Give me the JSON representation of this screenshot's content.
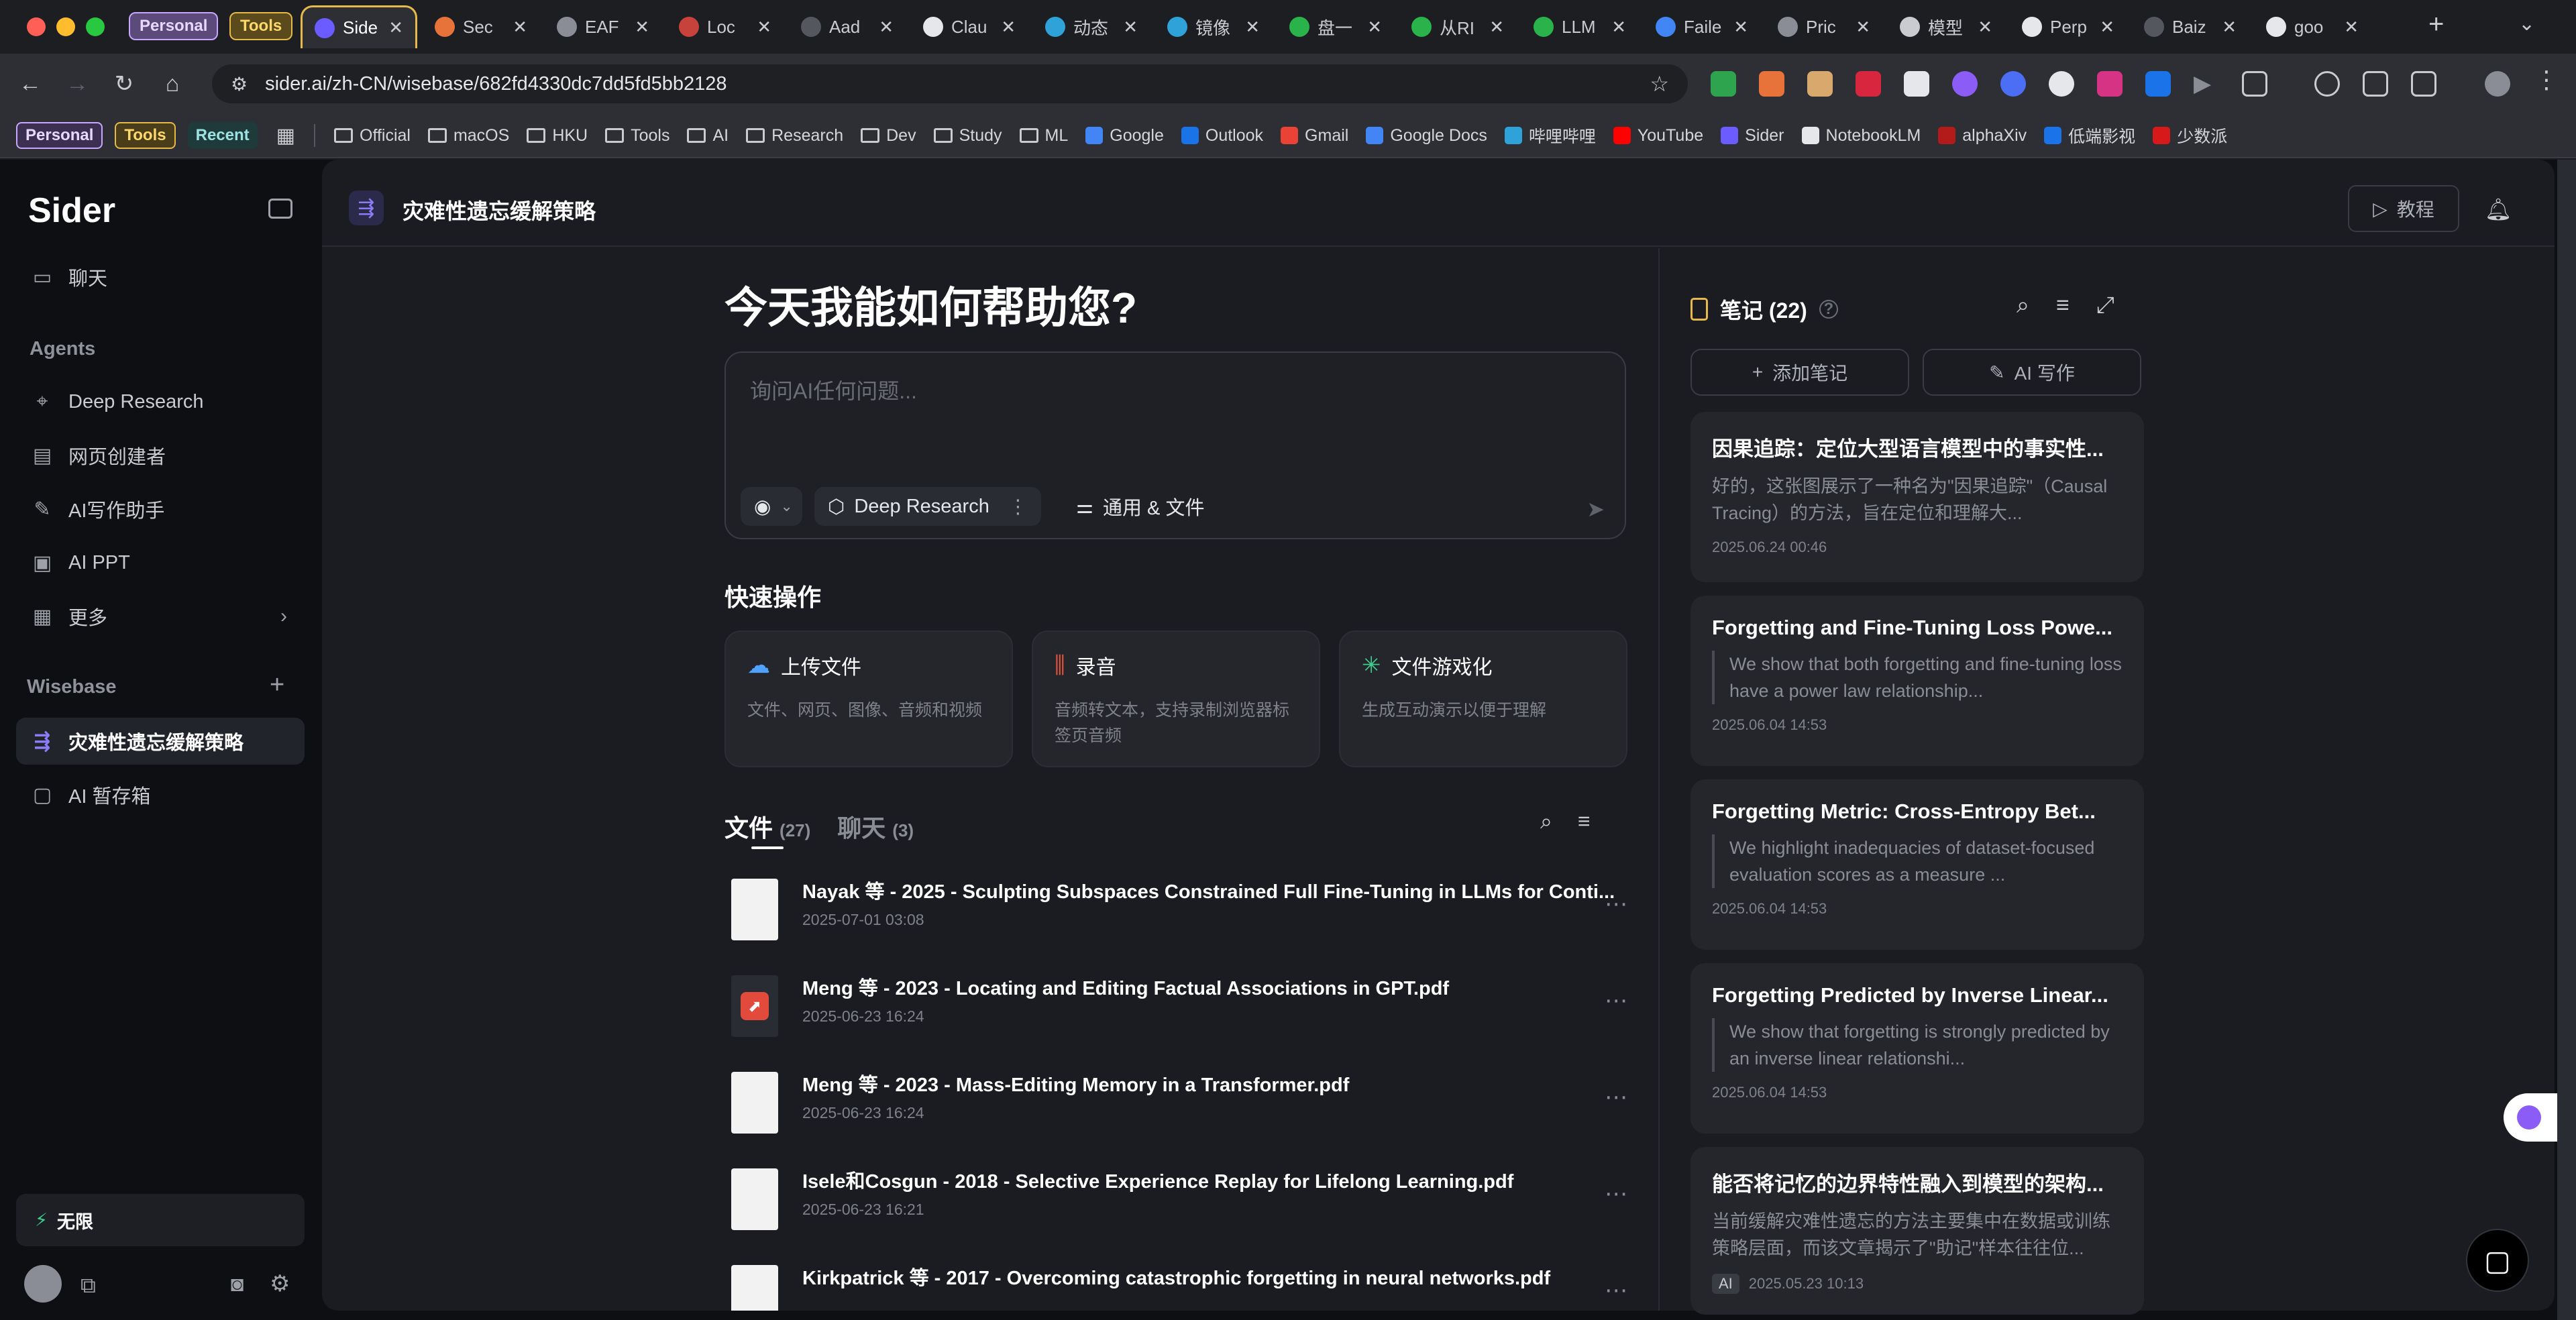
{
  "browser": {
    "groups": [
      "Personal",
      "Tools"
    ],
    "tabs": [
      {
        "title": "Side",
        "color": "#6b5cff",
        "active": true
      },
      {
        "title": "Sec",
        "color": "#e8733a"
      },
      {
        "title": "EAF",
        "color": "#8a8d95"
      },
      {
        "title": "Loc",
        "color": "#c7423a"
      },
      {
        "title": "Aad",
        "color": "#55575e"
      },
      {
        "title": "Clau",
        "color": "#e6e7ea"
      },
      {
        "title": "动态",
        "color": "#2fa3d9"
      },
      {
        "title": "镜像",
        "color": "#2fa3d9"
      },
      {
        "title": "盘一",
        "color": "#29b34a"
      },
      {
        "title": "从RI",
        "color": "#29b34a"
      },
      {
        "title": "LLM",
        "color": "#29b34a"
      },
      {
        "title": "Faile",
        "color": "#4285f4"
      },
      {
        "title": "Pric",
        "color": "#8a8d95"
      },
      {
        "title": "模型",
        "color": "#c9cbd1"
      },
      {
        "title": "Perp",
        "color": "#e6e7ea"
      },
      {
        "title": "Baiz",
        "color": "#55575e"
      },
      {
        "title": "goo",
        "color": "#e6e7ea"
      }
    ],
    "url": "sider.ai/zh-CN/wisebase/682fd4330dc7dd5fd5bb2128",
    "bookmark_groups": [
      "Personal",
      "Tools",
      "Recent"
    ],
    "bookmarks": [
      {
        "label": "Official",
        "icon": "folder-icon"
      },
      {
        "label": "macOS",
        "icon": "folder-icon"
      },
      {
        "label": "HKU",
        "icon": "folder-icon"
      },
      {
        "label": "Tools",
        "icon": "folder-icon"
      },
      {
        "label": "AI",
        "icon": "folder-icon"
      },
      {
        "label": "Research",
        "icon": "folder-icon"
      },
      {
        "label": "Dev",
        "icon": "folder-icon"
      },
      {
        "label": "Study",
        "icon": "folder-icon"
      },
      {
        "label": "ML",
        "icon": "folder-icon"
      },
      {
        "label": "Google",
        "icon": "google-icon",
        "color": "#4285f4"
      },
      {
        "label": "Outlook",
        "icon": "outlook-icon",
        "color": "#1a73e8"
      },
      {
        "label": "Gmail",
        "icon": "gmail-icon",
        "color": "#ea4335"
      },
      {
        "label": "Google Docs",
        "icon": "docs-icon",
        "color": "#4285f4"
      },
      {
        "label": "哔哩哔哩",
        "icon": "bilibili-icon",
        "color": "#2fa3d9"
      },
      {
        "label": "YouTube",
        "icon": "youtube-icon",
        "color": "#ff0000"
      },
      {
        "label": "Sider",
        "icon": "sider-icon",
        "color": "#6b5cff"
      },
      {
        "label": "NotebookLM",
        "icon": "notebooklm-icon",
        "color": "#e6e7ea"
      },
      {
        "label": "alphaXiv",
        "icon": "alphaxiv-icon",
        "color": "#b31b1b"
      },
      {
        "label": "低端影视",
        "icon": "ddys-icon",
        "color": "#1a73e8"
      },
      {
        "label": "少数派",
        "icon": "sspai-icon",
        "color": "#d7191a"
      }
    ]
  },
  "sidebar": {
    "logo": "Sider",
    "chat": "聊天",
    "agents_title": "Agents",
    "agents": [
      "Deep Research",
      "网页创建者",
      "AI写作助手",
      "AI PPT",
      "更多"
    ],
    "wisebase_title": "Wisebase",
    "wisebase_items": [
      "灾难性遗忘缓解策略",
      "AI 暂存箱"
    ],
    "plan": "无限"
  },
  "main": {
    "kb_title": "灾难性遗忘缓解策略",
    "tutorial": "教程",
    "greeting": "今天我能如何帮助您?",
    "placeholder": "询问AI任何问题...",
    "deep_research": "Deep Research",
    "scope": "通用 & 文件",
    "quick_title": "快速操作",
    "quick": [
      {
        "title": "上传文件",
        "desc": "文件、网页、图像、音频和视频",
        "color": "#4fa3ff"
      },
      {
        "title": "录音",
        "desc": "音频转文本，支持录制浏览器标签页音频",
        "color": "#e5533d"
      },
      {
        "title": "文件游戏化",
        "desc": "生成互动演示以便于理解",
        "color": "#3ecf8e"
      }
    ],
    "files_tab": "文件",
    "files_count": "(27)",
    "chats_tab": "聊天",
    "chats_count": "(3)",
    "files": [
      {
        "name": "Nayak 等 - 2025 - Sculpting Subspaces Constrained Full Fine-Tuning in LLMs for Conti...",
        "date": "2025-07-01 03:08",
        "kind": "doc"
      },
      {
        "name": "Meng 等 - 2023 - Locating and Editing Factual Associations in GPT.pdf",
        "date": "2025-06-23 16:24",
        "kind": "pdf"
      },
      {
        "name": "Meng 等 - 2023 - Mass-Editing Memory in a Transformer.pdf",
        "date": "2025-06-23 16:24",
        "kind": "doc"
      },
      {
        "name": "Isele和Cosgun - 2018 - Selective Experience Replay for Lifelong Learning.pdf",
        "date": "2025-06-23 16:21",
        "kind": "doc"
      },
      {
        "name": "Kirkpatrick 等 - 2017 - Overcoming catastrophic forgetting in neural networks.pdf",
        "date": "",
        "kind": "doc"
      }
    ]
  },
  "notes": {
    "title": "笔记 (22)",
    "add": "添加笔记",
    "ai_write": "AI 写作",
    "items": [
      {
        "title": "因果追踪：定位大型语言模型中的事实性...",
        "body": "好的，这张图展示了一种名为\"因果追踪\"（Causal Tracing）的方法，旨在定位和理解大...",
        "date": "2025.06.24 00:46",
        "quote": false
      },
      {
        "title": "Forgetting and Fine-Tuning Loss Powe...",
        "body": "We show that both forgetting and fine-tuning loss have a power law relationship...",
        "date": "2025.06.04 14:53",
        "quote": true
      },
      {
        "title": "Forgetting Metric: Cross-Entropy Bet...",
        "body": "We highlight inadequacies of dataset-focused evaluation scores as a measure ...",
        "date": "2025.06.04 14:53",
        "quote": true
      },
      {
        "title": "Forgetting Predicted by Inverse Linear...",
        "body": "We show that forgetting is strongly predicted by an inverse linear relationshi...",
        "date": "2025.06.04 14:53",
        "quote": true
      },
      {
        "title": "能否将记忆的边界特性融入到模型的架构...",
        "body": "当前缓解灾难性遗忘的方法主要集中在数据或训练策略层面，而该文章揭示了\"助记\"样本往往位...",
        "date": "2025.05.23 10:13",
        "quote": false,
        "badge": "AI"
      }
    ]
  }
}
